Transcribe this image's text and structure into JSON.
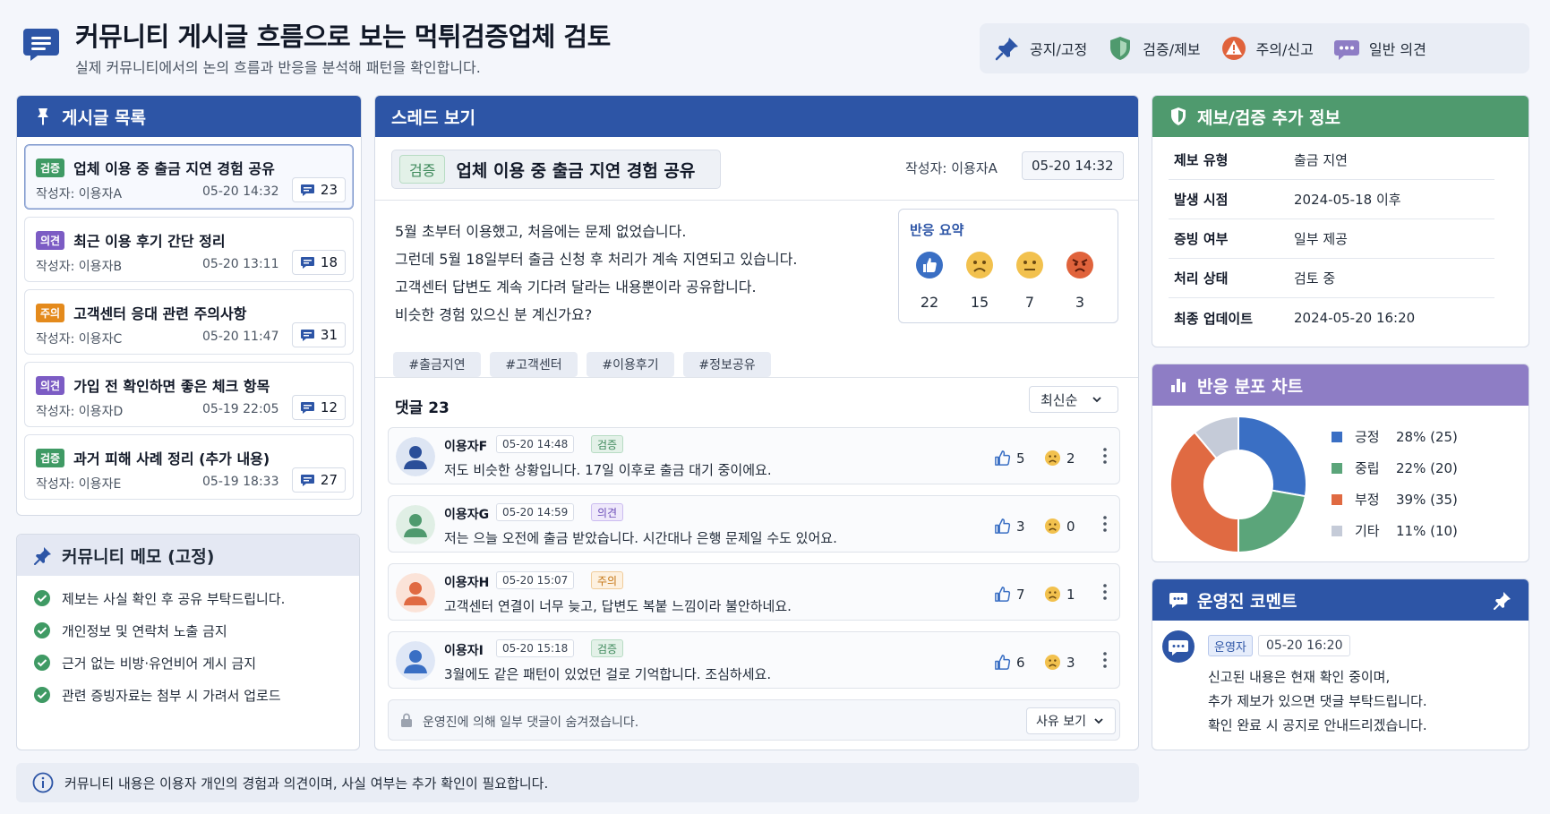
{
  "header": {
    "title": "커뮤니티 게시글 흐름으로 보는 먹튀검증업체 검토",
    "subtitle": "실제 커뮤니티에서의 논의 흐름과 반응을 분석해 패턴을 확인합니다."
  },
  "legend": [
    {
      "icon": "pin-icon",
      "label": "공지/고정"
    },
    {
      "icon": "shield-icon",
      "label": "검증/제보"
    },
    {
      "icon": "warning-icon",
      "label": "주의/신고"
    },
    {
      "icon": "chat-icon",
      "label": "일반 의견"
    }
  ],
  "post_list": {
    "title": "게시글 목록",
    "items": [
      {
        "tag": "검증",
        "title": "업체 이용 중 출금 지연 경험 공유",
        "author": "작성자: 이용자A",
        "date": "05-20 14:32",
        "count": "23"
      },
      {
        "tag": "의견",
        "title": "최근 이용 후기 간단 정리",
        "author": "작성자: 이용자B",
        "date": "05-20 13:11",
        "count": "18"
      },
      {
        "tag": "주의",
        "title": "고객센터 응대 관련 주의사항",
        "author": "작성자: 이용자C",
        "date": "05-20 11:47",
        "count": "31"
      },
      {
        "tag": "의견",
        "title": "가입 전 확인하면 좋은 체크 항목",
        "author": "작성자: 이용자D",
        "date": "05-19 22:05",
        "count": "12"
      },
      {
        "tag": "검증",
        "title": "과거 피해 사례 정리 (추가 내용)",
        "author": "작성자: 이용자E",
        "date": "05-19 18:33",
        "count": "27"
      }
    ]
  },
  "memo": {
    "title": "커뮤니티 메모 (고정)",
    "items": [
      "제보는 사실 확인 후 공유 부탁드립니다.",
      "개인정보 및 연락처 노출 금지",
      "근거 없는 비방·유언비어 게시 금지",
      "관련 증빙자료는 첨부 시 가려서 업로드"
    ]
  },
  "thread": {
    "title": "스레드 보기",
    "tag": "검증",
    "post_title": "업체 이용 중 출금 지연 경험 공유",
    "author": "작성자: 이용자A",
    "date": "05-20 14:32",
    "body": [
      "5월 초부터 이용했고, 처음에는 문제 없었습니다.",
      "그런데 5월 18일부터 출금 신청 후 처리가 계속 지연되고 있습니다.",
      "고객센터 답변도 계속 기다려 달라는 내용뿐이라 공유합니다.",
      "비슷한 경험 있으신 분 계신가요?"
    ],
    "hashtags": [
      "#출금지연",
      "#고객센터",
      "#이용후기",
      "#정보공유"
    ],
    "reaction_summary": {
      "title": "반응 요약",
      "like": "22",
      "sad": "15",
      "neutral": "7",
      "angry": "3"
    },
    "comments_label": "댓글 23",
    "sort": "최신순",
    "comments": [
      {
        "user": "이용자F",
        "date": "05-20 14:48",
        "tag": "검증",
        "text": "저도 비슷한 상황입니다. 17일 이후로 출금 대기 중이에요.",
        "likes": "5",
        "sads": "2"
      },
      {
        "user": "이용자G",
        "date": "05-20 14:59",
        "tag": "의견",
        "text": "저는 으늘 오전에 출금 받았습니다. 시간대나 은행 문제일 수도 있어요.",
        "likes": "3",
        "sads": "0"
      },
      {
        "user": "이용자H",
        "date": "05-20 15:07",
        "tag": "주의",
        "text": "고객센터 연결이 너무 늦고, 답변도 복붙 느낌이라 불안하네요.",
        "likes": "7",
        "sads": "1"
      },
      {
        "user": "이용자I",
        "date": "05-20 15:18",
        "tag": "검증",
        "text": "3월에도 같은 패턴이 있었던 걸로 기억합니다. 조심하세요.",
        "likes": "6",
        "sads": "3"
      }
    ],
    "hidden_notice": "운영진에 의해 일부 댓글이 숨겨졌습니다.",
    "reason_button": "사유 보기"
  },
  "report_info": {
    "title": "제보/검증 추가 정보",
    "rows": [
      {
        "key": "제보 유형",
        "value": "출금 지연"
      },
      {
        "key": "발생 시점",
        "value": "2024-05-18 이후"
      },
      {
        "key": "증빙 여부",
        "value": "일부 제공"
      },
      {
        "key": "처리 상태",
        "value": "검토 중"
      },
      {
        "key": "최종 업데이트",
        "value": "2024-05-20 16:20"
      }
    ]
  },
  "chart_panel": {
    "title": "반응 분포 차트"
  },
  "chart_data": {
    "type": "pie",
    "title": "",
    "categories": [
      "긍정",
      "중립",
      "부정",
      "기타"
    ],
    "labels": [
      "28% (25)",
      "22% (20)",
      "39% (35)",
      "11% (10)"
    ],
    "values": [
      25,
      20,
      35,
      10
    ],
    "percents": [
      28,
      22,
      39,
      11
    ],
    "colors": [
      "#3a6fc4",
      "#5ba57a",
      "#e06a42",
      "#c5cbd8"
    ],
    "legend_position": "right"
  },
  "admin_comment": {
    "title": "운영진 코멘트",
    "tag": "운영자",
    "date": "05-20 16:20",
    "lines": [
      "신고된 내용은 현재 확인 중이며,",
      "추가 제보가 있으면 댓글 부탁드립니다.",
      "확인 완료 시 공지로 안내드리겠습니다."
    ]
  },
  "footer": {
    "text": "커뮤니티 내용은 이용자 개인의 경험과 의견이며, 사실 여부는 추가 확인이 필요합니다."
  },
  "colors": {
    "primary": "#2d55a6",
    "green": "#4f9a6e",
    "purple": "#8e7dc5",
    "orange": "#e48a1c"
  }
}
